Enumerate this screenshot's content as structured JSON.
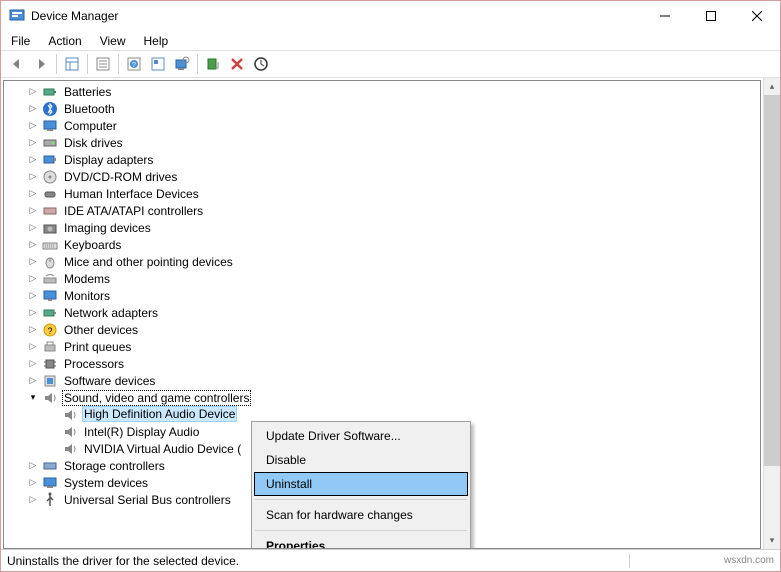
{
  "window": {
    "title": "Device Manager"
  },
  "menubar": {
    "file": "File",
    "action": "Action",
    "view": "View",
    "help": "Help"
  },
  "tree": {
    "cat": {
      "batteries": "Batteries",
      "bluetooth": "Bluetooth",
      "computer": "Computer",
      "disk": "Disk drives",
      "display": "Display adapters",
      "dvd": "DVD/CD-ROM drives",
      "hid": "Human Interface Devices",
      "ide": "IDE ATA/ATAPI controllers",
      "imaging": "Imaging devices",
      "keyboards": "Keyboards",
      "mice": "Mice and other pointing devices",
      "modems": "Modems",
      "monitors": "Monitors",
      "netadapt": "Network adapters",
      "other": "Other devices",
      "printq": "Print queues",
      "processors": "Processors",
      "softdev": "Software devices",
      "sound": "Sound, video and game controllers",
      "storage": "Storage controllers",
      "sysdev": "System devices",
      "usb": "Universal Serial Bus controllers"
    },
    "sound_children": {
      "hda": "High Definition Audio Device",
      "intel": "Intel(R) Display Audio",
      "nvidia": "NVIDIA Virtual Audio Device ("
    }
  },
  "ctx": {
    "update": "Update Driver Software...",
    "disable": "Disable",
    "uninstall": "Uninstall",
    "scan": "Scan for hardware changes",
    "properties": "Properties"
  },
  "statusbar": {
    "text": "Uninstalls the driver for the selected device.",
    "watermark": "wsxdn.com"
  }
}
